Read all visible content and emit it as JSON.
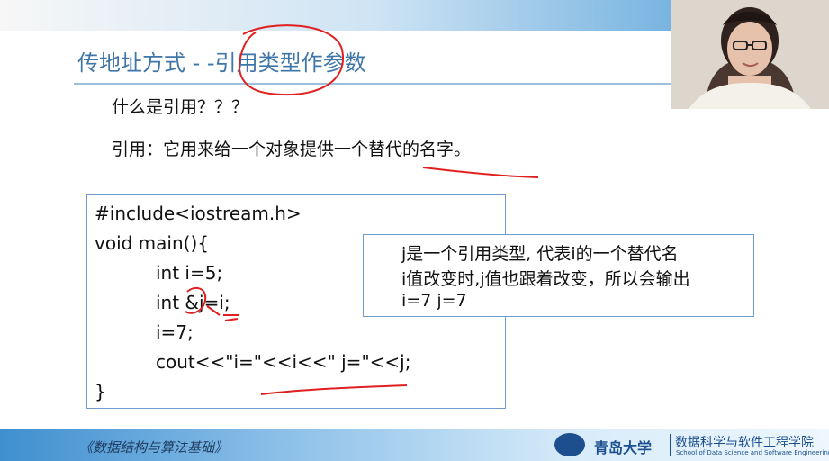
{
  "slide": {
    "title": "传地址方式 - -引用类型作参数",
    "question": "什么是引用？？？",
    "definition": "引用：它用来给一个对象提供一个替代的名字。"
  },
  "code": {
    "lines": [
      "#include<iostream.h>",
      "void main(){",
      "int i=5;",
      "int &j=i;",
      "i=7;",
      "cout<<\"i=\"<<i<<\" j=\"<<j;",
      "}"
    ]
  },
  "note": {
    "lines": [
      "j是一个引用类型, 代表i的一个替代名",
      "i值改变时,j值也跟着改变，所以会输出",
      "i=7 j=7"
    ]
  },
  "footer": {
    "course": "《数据结构与算法基础》",
    "university": "青岛大学",
    "college_cn": "数据科学与软件工程学院",
    "college_en": "School of Data Science and Software Engineering"
  },
  "colors": {
    "title": "#3f76a8",
    "annotation": "#e02020",
    "box_border": "#6f9ccc",
    "footer_band": "#3f8fcf"
  },
  "icons": {
    "webcam": "presenter-video",
    "logo": "university-emblem"
  }
}
